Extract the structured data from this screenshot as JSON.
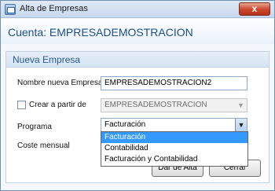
{
  "window": {
    "title": "Alta de Empresas",
    "close_label": "x"
  },
  "header": {
    "cuenta_label": "Cuenta: EMPRESADEMOSTRACION"
  },
  "section": {
    "title": "Nueva Empresa",
    "nombre_label": "Nombre nueva Empresa",
    "nombre_value": "EMPRESADEMOSTRACION2",
    "crear_label": "Crear a partir de",
    "crear_checked": false,
    "crear_value": "EMPRESADEMOSTRACION",
    "programa_label": "Programa",
    "programa_value": "Facturación",
    "coste_label": "Coste mensual"
  },
  "dropdown": {
    "options": [
      "Facturación",
      "Contabilidad",
      "Facturación y Contabilidad"
    ],
    "selected_index": 0
  },
  "buttons": {
    "dar_alta": "Dar de Alta",
    "cerrar": "Cerrar"
  },
  "icons": {
    "app": "form-window-icon",
    "close": "close-icon",
    "arrow": "chevron-down-icon"
  },
  "colors": {
    "accent": "#1e4f8a",
    "selection": "#3399ff",
    "close": "#c9452a"
  }
}
